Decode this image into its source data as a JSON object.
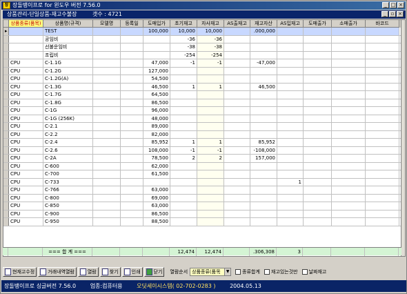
{
  "window": {
    "title": "장돌뱅이프로 for 윈도우 버전 7.56.0",
    "app_icon": "장"
  },
  "mdi": {
    "title": "상품관리-단일상품-재고수불장",
    "count_label": "갯수 : 4721"
  },
  "grid": {
    "headers": [
      "상품종류(품목)",
      "상품명(규격)",
      "모델명",
      "등록일",
      "도매입가",
      "초기재고",
      "자사재고",
      "AS출재고",
      "재고자산",
      "AS입재고",
      "도매출가",
      "소매출가",
      "바코드"
    ],
    "rows": [
      {
        "kind": "",
        "name": "TEST",
        "model": "",
        "date": "",
        "price": "100,000",
        "init": "10,000",
        "own": "10,000",
        "as_out": "",
        "asset": ".000,000",
        "as_in": "",
        "whole": "",
        "retail": "",
        "barcode": ""
      },
      {
        "kind": "",
        "name": "공임비",
        "model": "",
        "date": "",
        "price": "",
        "init": "-36",
        "own": "-36",
        "as_out": "",
        "asset": "",
        "as_in": "",
        "whole": "",
        "retail": "",
        "barcode": ""
      },
      {
        "kind": "",
        "name": "선불운임비",
        "model": "",
        "date": "",
        "price": "",
        "init": "-38",
        "own": "-38",
        "as_out": "",
        "asset": "",
        "as_in": "",
        "whole": "",
        "retail": "",
        "barcode": ""
      },
      {
        "kind": "",
        "name": "조립비",
        "model": "",
        "date": "",
        "price": "",
        "init": "-254",
        "own": "-254",
        "as_out": "",
        "asset": "",
        "as_in": "",
        "whole": "",
        "retail": "",
        "barcode": ""
      },
      {
        "kind": "CPU",
        "name": "C-1.1G",
        "model": "",
        "date": "",
        "price": "47,000",
        "init": "-1",
        "own": "-1",
        "as_out": "",
        "asset": "-47,000",
        "as_in": "",
        "whole": "",
        "retail": "",
        "barcode": ""
      },
      {
        "kind": "CPU",
        "name": "C-1.2G",
        "model": "",
        "date": "",
        "price": "127,000",
        "init": "",
        "own": "",
        "as_out": "",
        "asset": "",
        "as_in": "",
        "whole": "",
        "retail": "",
        "barcode": ""
      },
      {
        "kind": "CPU",
        "name": "C-1.2G(A)",
        "model": "",
        "date": "",
        "price": "54,500",
        "init": "",
        "own": "",
        "as_out": "",
        "asset": "",
        "as_in": "",
        "whole": "",
        "retail": "",
        "barcode": ""
      },
      {
        "kind": "CPU",
        "name": "C-1.3G",
        "model": "",
        "date": "",
        "price": "46,500",
        "init": "1",
        "own": "1",
        "as_out": "",
        "asset": "46,500",
        "as_in": "",
        "whole": "",
        "retail": "",
        "barcode": ""
      },
      {
        "kind": "CPU",
        "name": "C-1.7G",
        "model": "",
        "date": "",
        "price": "64,500",
        "init": "",
        "own": "",
        "as_out": "",
        "asset": "",
        "as_in": "",
        "whole": "",
        "retail": "",
        "barcode": ""
      },
      {
        "kind": "CPU",
        "name": "C-1.8G",
        "model": "",
        "date": "",
        "price": "86,500",
        "init": "",
        "own": "",
        "as_out": "",
        "asset": "",
        "as_in": "",
        "whole": "",
        "retail": "",
        "barcode": ""
      },
      {
        "kind": "CPU",
        "name": "C-1G",
        "model": "",
        "date": "",
        "price": "96,000",
        "init": "",
        "own": "",
        "as_out": "",
        "asset": "",
        "as_in": "",
        "whole": "",
        "retail": "",
        "barcode": ""
      },
      {
        "kind": "CPU",
        "name": "C-1G (256K)",
        "model": "",
        "date": "",
        "price": "48,000",
        "init": "",
        "own": "",
        "as_out": "",
        "asset": "",
        "as_in": "",
        "whole": "",
        "retail": "",
        "barcode": ""
      },
      {
        "kind": "CPU",
        "name": "C-2.1",
        "model": "",
        "date": "",
        "price": "89,000",
        "init": "",
        "own": "",
        "as_out": "",
        "asset": "",
        "as_in": "",
        "whole": "",
        "retail": "",
        "barcode": ""
      },
      {
        "kind": "CPU",
        "name": "C-2.2",
        "model": "",
        "date": "",
        "price": "82,000",
        "init": "",
        "own": "",
        "as_out": "",
        "asset": "",
        "as_in": "",
        "whole": "",
        "retail": "",
        "barcode": ""
      },
      {
        "kind": "CPU",
        "name": "C-2.4",
        "model": "",
        "date": "",
        "price": "85,952",
        "init": "1",
        "own": "1",
        "as_out": "",
        "asset": "85,952",
        "as_in": "",
        "whole": "",
        "retail": "",
        "barcode": ""
      },
      {
        "kind": "CPU",
        "name": "C-2.6",
        "model": "",
        "date": "",
        "price": "108,000",
        "init": "-1",
        "own": "-1",
        "as_out": "",
        "asset": "-108,000",
        "as_in": "",
        "whole": "",
        "retail": "",
        "barcode": ""
      },
      {
        "kind": "CPU",
        "name": "C-2A",
        "model": "",
        "date": "",
        "price": "78,500",
        "init": "2",
        "own": "2",
        "as_out": "",
        "asset": "157,000",
        "as_in": "",
        "whole": "",
        "retail": "",
        "barcode": ""
      },
      {
        "kind": "CPU",
        "name": "C-600",
        "model": "",
        "date": "",
        "price": "62,000",
        "init": "",
        "own": "",
        "as_out": "",
        "asset": "",
        "as_in": "",
        "whole": "",
        "retail": "",
        "barcode": ""
      },
      {
        "kind": "CPU",
        "name": "C-700",
        "model": "",
        "date": "",
        "price": "61,500",
        "init": "",
        "own": "",
        "as_out": "",
        "asset": "",
        "as_in": "",
        "whole": "",
        "retail": "",
        "barcode": ""
      },
      {
        "kind": "CPU",
        "name": "C-733",
        "model": "",
        "date": "",
        "price": "",
        "init": "",
        "own": "",
        "as_out": "",
        "asset": "",
        "as_in": "1",
        "whole": "",
        "retail": "",
        "barcode": ""
      },
      {
        "kind": "CPU",
        "name": "C-766",
        "model": "",
        "date": "",
        "price": "63,000",
        "init": "",
        "own": "",
        "as_out": "",
        "asset": "",
        "as_in": "",
        "whole": "",
        "retail": "",
        "barcode": ""
      },
      {
        "kind": "CPU",
        "name": "C-800",
        "model": "",
        "date": "",
        "price": "69,000",
        "init": "",
        "own": "",
        "as_out": "",
        "asset": "",
        "as_in": "",
        "whole": "",
        "retail": "",
        "barcode": ""
      },
      {
        "kind": "CPU",
        "name": "C-850",
        "model": "",
        "date": "",
        "price": "63,000",
        "init": "",
        "own": "",
        "as_out": "",
        "asset": "",
        "as_in": "",
        "whole": "",
        "retail": "",
        "barcode": ""
      },
      {
        "kind": "CPU",
        "name": "C-900",
        "model": "",
        "date": "",
        "price": "86,500",
        "init": "",
        "own": "",
        "as_out": "",
        "asset": "",
        "as_in": "",
        "whole": "",
        "retail": "",
        "barcode": ""
      },
      {
        "kind": "CPU",
        "name": "C-950",
        "model": "",
        "date": "",
        "price": "88,500",
        "init": "",
        "own": "",
        "as_out": "",
        "asset": "",
        "as_in": "",
        "whole": "",
        "retail": "",
        "barcode": ""
      }
    ],
    "total": {
      "label": "=== 합 계 ===",
      "init": "12,474",
      "own": "12,474",
      "asset": ".306,308",
      "as_in": "3"
    }
  },
  "toolbar": {
    "btn_edit_stock": "현재고수정",
    "btn_history": "거래내역열람",
    "btn_view": "열람",
    "btn_find": "찾기",
    "btn_print": "인쇄",
    "btn_close": "닫기",
    "sort_label": "열람순서",
    "sort_value": "상품종류(품목",
    "chk_sum_by_kind": "종류합계",
    "chk_only_stock": "재고있는것만",
    "chk_date_stock": "날짜재고"
  },
  "status": {
    "version": "장돌뱅이프로 싱글버전 7.56.0",
    "business": "업종:컴퓨터용",
    "company": "오딧세이시스템( 02-702-0283 )",
    "date": "2004.05.13"
  }
}
